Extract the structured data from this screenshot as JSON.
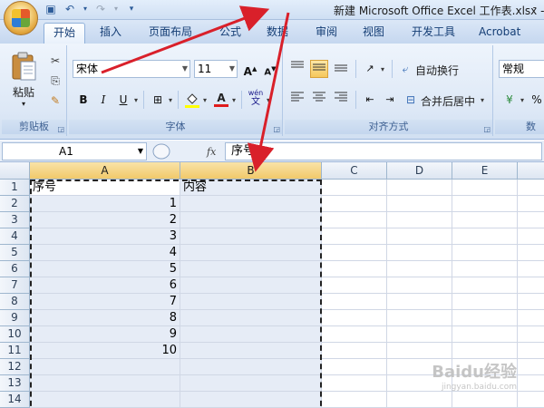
{
  "window": {
    "title": "新建 Microsoft Office Excel 工作表.xlsx -",
    "minimize": "-"
  },
  "qat": {
    "save_icon": "save-icon",
    "undo_icon": "undo-icon",
    "redo_icon": "redo-icon",
    "customize_icon": "chevron-down-icon"
  },
  "tabs": [
    {
      "label": "开始",
      "active": true
    },
    {
      "label": "插入"
    },
    {
      "label": "页面布局"
    },
    {
      "label": "公式"
    },
    {
      "label": "数据"
    },
    {
      "label": "审阅"
    },
    {
      "label": "视图"
    },
    {
      "label": "开发工具"
    },
    {
      "label": "Acrobat"
    }
  ],
  "ribbon": {
    "clipboard": {
      "paste_label": "粘贴",
      "group_label": "剪贴板"
    },
    "font": {
      "font_name": "宋体",
      "font_size": "11",
      "group_label": "字体",
      "bold": "B",
      "italic": "I",
      "underline": "U",
      "grow": "A",
      "shrink": "A",
      "font_color_letter": "A",
      "phonetic": "wén"
    },
    "alignment": {
      "wrap_text": "自动换行",
      "merge_center": "合并后居中",
      "group_label": "对齐方式"
    },
    "number": {
      "format": "常规",
      "group_label": "数"
    }
  },
  "formula_bar": {
    "name_box": "A1",
    "fx": "fx",
    "content": "序号"
  },
  "sheet": {
    "columns": [
      "A",
      "B",
      "C",
      "D",
      "E"
    ],
    "rows": [
      "1",
      "2",
      "3",
      "4",
      "5",
      "6",
      "7",
      "8",
      "9",
      "10",
      "11",
      "12",
      "13",
      "14"
    ],
    "header_a": "序号",
    "header_b": "内容",
    "values_a": [
      "1",
      "2",
      "3",
      "4",
      "5",
      "6",
      "7",
      "8",
      "9",
      "10"
    ]
  },
  "colors": {
    "accent": "#153e75",
    "annotation_arrow": "#d9202a",
    "selection_header": "#f1c96a",
    "selection_fill": "#e6ecf6"
  },
  "watermark": {
    "brand": "Baidu经验",
    "url": "jingyan.baidu.com"
  }
}
